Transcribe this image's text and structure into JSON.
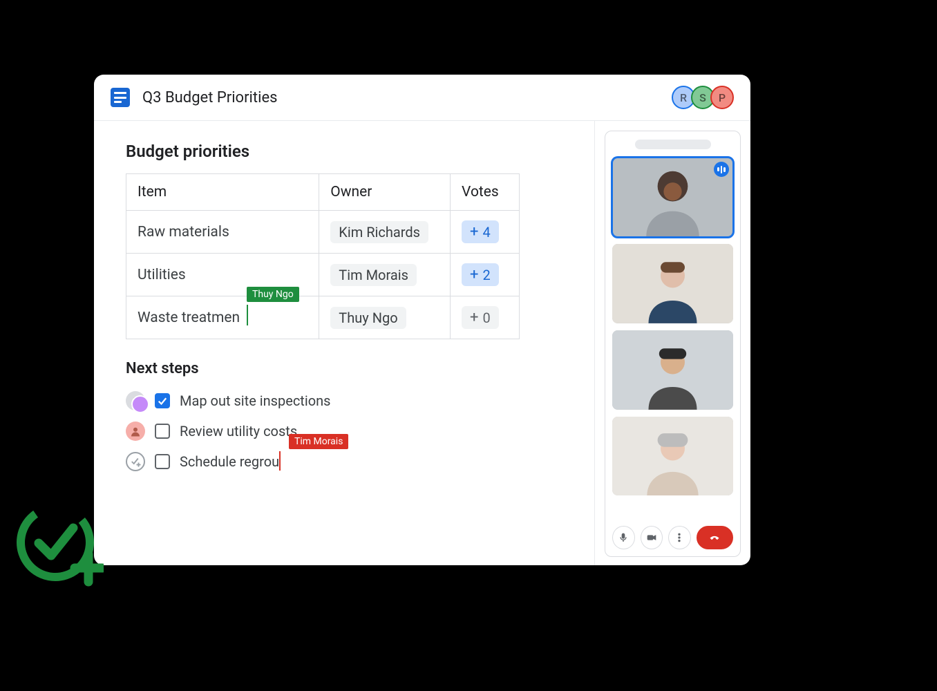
{
  "header": {
    "doc_title": "Q3 Budget Priorities",
    "collaborators": [
      {
        "initial": "R",
        "color": "blue"
      },
      {
        "initial": "S",
        "color": "green"
      },
      {
        "initial": "P",
        "color": "red"
      }
    ]
  },
  "priorities": {
    "heading": "Budget priorities",
    "columns": {
      "item": "Item",
      "owner": "Owner",
      "votes": "Votes"
    },
    "rows": [
      {
        "item": "Raw materials",
        "owner": "Kim Richards",
        "votes": 4,
        "vote_active": true
      },
      {
        "item": "Utilities",
        "owner": "Tim Morais",
        "votes": 2,
        "vote_active": true
      },
      {
        "item": "Waste treatmen",
        "owner": "Thuy Ngo",
        "votes": 0,
        "vote_active": false
      }
    ],
    "edit_cursor": {
      "label": "Thuy Ngo",
      "color": "green"
    }
  },
  "next_steps": {
    "heading": "Next steps",
    "tasks": [
      {
        "text": "Map out site inspections",
        "checked": true,
        "assignee_type": "pair"
      },
      {
        "text": "Review utility costs",
        "checked": false,
        "assignee_type": "single"
      },
      {
        "text": "Schedule regrou",
        "checked": false,
        "assignee_type": "unassigned"
      }
    ],
    "edit_cursor": {
      "label": "Tim Morais",
      "color": "red"
    }
  },
  "meet": {
    "participant_states": [
      "speaking",
      "",
      "",
      ""
    ],
    "controls": [
      "mic",
      "camera",
      "more",
      "end-call"
    ]
  }
}
